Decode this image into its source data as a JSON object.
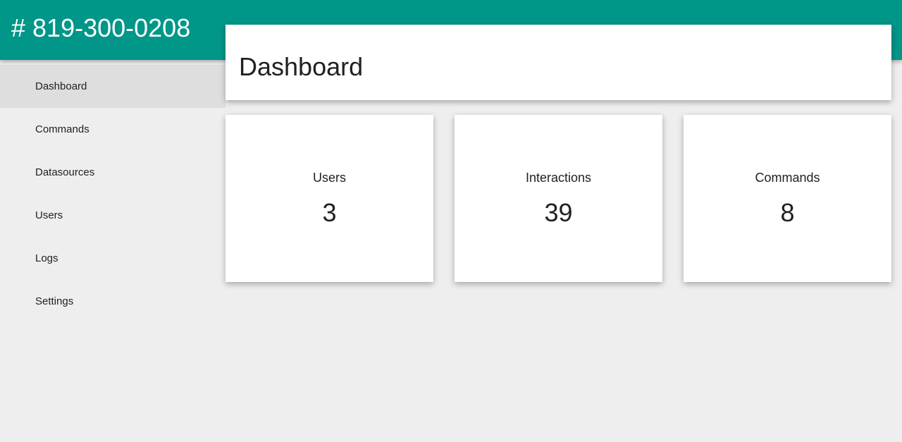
{
  "app": {
    "title": "# 819-300-0208"
  },
  "sidebar": {
    "items": [
      {
        "label": "Dashboard",
        "active": true
      },
      {
        "label": "Commands"
      },
      {
        "label": "Datasources"
      },
      {
        "label": "Users"
      },
      {
        "label": "Logs"
      },
      {
        "label": "Settings"
      }
    ]
  },
  "page": {
    "title": "Dashboard"
  },
  "stats": [
    {
      "label": "Users",
      "value": "3"
    },
    {
      "label": "Interactions",
      "value": "39"
    },
    {
      "label": "Commands",
      "value": "8"
    }
  ],
  "colors": {
    "primary": "#009688",
    "background": "#eeeeee",
    "active_nav": "#dedede",
    "card": "#ffffff",
    "text": "#212121"
  }
}
